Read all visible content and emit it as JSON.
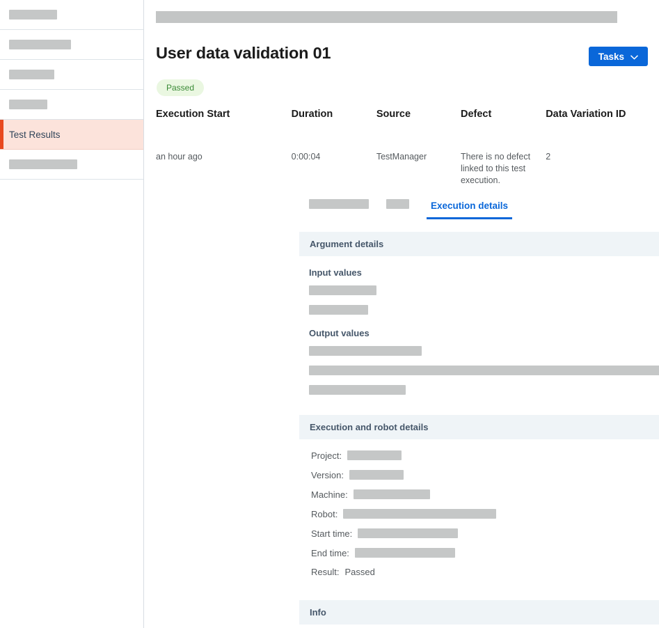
{
  "sidebar": {
    "items": [
      {
        "label": "",
        "redacted": true,
        "redact_width": 69
      },
      {
        "label": "",
        "redacted": true,
        "redact_width": 89
      },
      {
        "label": "",
        "redacted": true,
        "redact_width": 65
      },
      {
        "label": "",
        "redacted": true,
        "redact_width": 55
      },
      {
        "label": "Test Results",
        "redacted": false,
        "active": true
      },
      {
        "label": "",
        "redacted": true,
        "redact_width": 98
      }
    ]
  },
  "header": {
    "title": "User data validation 01",
    "status_badge": "Passed",
    "tasks_button": "Tasks",
    "tasks_chevron_icon": "chevron-down-icon",
    "topbar_redact_width": 663
  },
  "execution_table": {
    "columns": [
      "Execution Start",
      "Duration",
      "Source",
      "Defect",
      "Data Variation ID"
    ],
    "rows": [
      {
        "execution_start": "an hour ago",
        "duration": "0:00:04",
        "source": "TestManager",
        "defect": "There is no defect linked to this test execution.",
        "data_variation_id": "2"
      }
    ]
  },
  "tabs": [
    {
      "label": "",
      "redacted": true,
      "redact_width": 86,
      "active": false
    },
    {
      "label": "",
      "redacted": true,
      "redact_width": 33,
      "active": false
    },
    {
      "label": "Execution details",
      "redacted": false,
      "active": true
    }
  ],
  "sections": {
    "argument_details": {
      "title": "Argument details",
      "toggle_icon": "redacted-chevron-icon",
      "input_label": "Input values",
      "input_values": [
        {
          "redact_width": 97
        },
        {
          "redact_width": 85
        }
      ],
      "output_label": "Output values",
      "output_values": [
        {
          "redact_width": 162
        },
        {
          "redact_width": 610
        },
        {
          "redact_width": 139
        }
      ]
    },
    "execution_and_robot_details": {
      "title": "Execution and robot details",
      "toggle_icon": "chevron-up-icon",
      "fields": [
        {
          "key": "Project:",
          "value": "",
          "redacted": true,
          "redact_width": 78
        },
        {
          "key": "Version:",
          "value": "",
          "redacted": true,
          "redact_width": 78
        },
        {
          "key": "Machine:",
          "value": "",
          "redacted": true,
          "redact_width": 110
        },
        {
          "key": "Robot:",
          "value": "",
          "redacted": true,
          "redact_width": 220
        },
        {
          "key": "Start time:",
          "value": "",
          "redacted": true,
          "redact_width": 144
        },
        {
          "key": "End time:",
          "value": "",
          "redacted": true,
          "redact_width": 144
        },
        {
          "key": "Result:",
          "value": "Passed",
          "redacted": false
        }
      ]
    },
    "info": {
      "title": "Info",
      "toggle_icon": "redacted-chevron-icon"
    }
  },
  "colors": {
    "accent_blue": "#0a67d9",
    "active_sidebar_bar": "#e8491f",
    "active_sidebar_bg": "#fce3db",
    "badge_bg": "#eaf7e1",
    "badge_text": "#3a8a36",
    "section_head_bg": "#eff4f7",
    "redaction": "#c5c7c7"
  }
}
